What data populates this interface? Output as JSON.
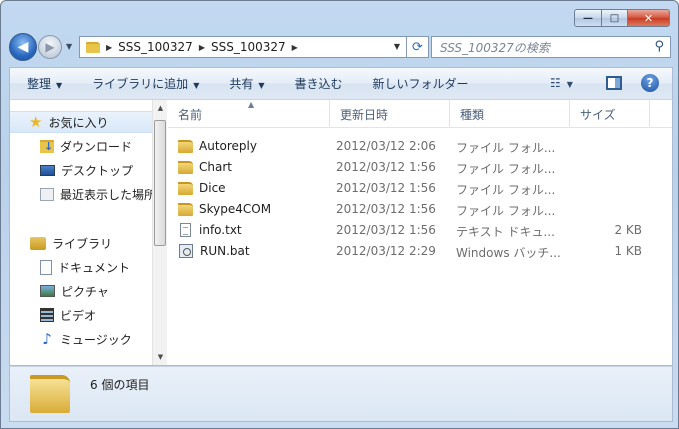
{
  "window": {
    "caption_buttons": {
      "minimize": "—",
      "maximize": "□",
      "close": "✕"
    }
  },
  "nav": {
    "back_icon": "◀",
    "forward_icon": "▶",
    "history_dropdown_icon": "▼"
  },
  "address": {
    "segments": [
      "SSS_100327",
      "SSS_100327"
    ],
    "separator": "▶",
    "dropdown_icon": "▼",
    "refresh_icon": "⟳"
  },
  "search": {
    "placeholder": "SSS_100327の検索",
    "icon": "⚲"
  },
  "toolbar": {
    "organize": "整理",
    "library": "ライブラリに追加",
    "share": "共有",
    "burn": "書き込む",
    "new_folder": "新しいフォルダー",
    "caret": "▼",
    "view_icon": "☷",
    "help_icon": "?"
  },
  "sidebar": {
    "favorites": {
      "label": "お気に入り",
      "icon": "★"
    },
    "favorite_items": [
      {
        "label": "ダウンロード"
      },
      {
        "label": "デスクトップ"
      },
      {
        "label": "最近表示した場所"
      }
    ],
    "libraries": {
      "label": "ライブラリ"
    },
    "library_items": [
      {
        "label": "ドキュメント"
      },
      {
        "label": "ピクチャ"
      },
      {
        "label": "ビデオ"
      },
      {
        "label": "ミュージック",
        "icon": "♪"
      }
    ],
    "scroll_up_icon": "▲",
    "scroll_down_icon": "▼"
  },
  "file_list": {
    "columns": {
      "name": "名前",
      "date": "更新日時",
      "type": "種類",
      "size": "サイズ"
    },
    "sort_icon": "▲",
    "rows": [
      {
        "name": "Autoreply",
        "date": "2012/03/12 2:06",
        "type": "ファイル フォル...",
        "size": "",
        "kind": "folder"
      },
      {
        "name": "Chart",
        "date": "2012/03/12 1:56",
        "type": "ファイル フォル...",
        "size": "",
        "kind": "folder"
      },
      {
        "name": "Dice",
        "date": "2012/03/12 1:56",
        "type": "ファイル フォル...",
        "size": "",
        "kind": "folder"
      },
      {
        "name": "Skype4COM",
        "date": "2012/03/12 1:56",
        "type": "ファイル フォル...",
        "size": "",
        "kind": "folder"
      },
      {
        "name": "info.txt",
        "date": "2012/03/12 1:56",
        "type": "テキスト ドキュ...",
        "size": "2 KB",
        "kind": "text"
      },
      {
        "name": "RUN.bat",
        "date": "2012/03/12 2:29",
        "type": "Windows バッチ...",
        "size": "1 KB",
        "kind": "batch"
      }
    ]
  },
  "details": {
    "item_count": "6 個の項目"
  }
}
